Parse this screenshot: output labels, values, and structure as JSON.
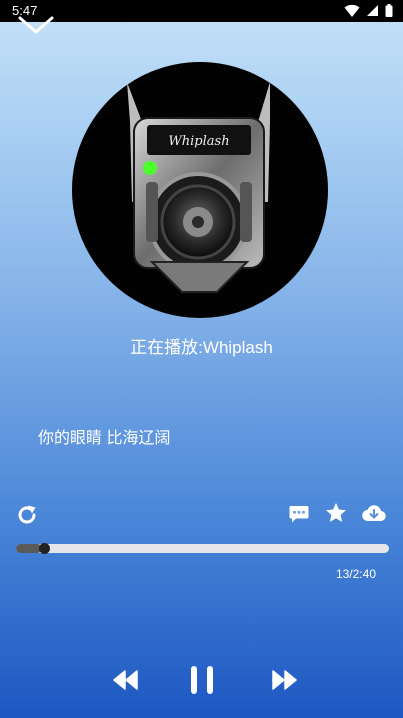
{
  "status_bar": {
    "time": "5:47"
  },
  "player": {
    "now_playing": "正在播放:Whiplash",
    "album_art_text": "Whiplash",
    "lyric_line": "你的眼睛 比海辽阔",
    "progress": {
      "fraction": 0.045,
      "time_display": "13/2:40"
    }
  },
  "icons": {
    "collapse": "chevron-down-icon",
    "repeat": "repeat-icon",
    "comment": "comment-icon",
    "favorite": "star-icon",
    "download": "download-icon",
    "previous": "rewind-icon",
    "play_pause": "pause-icon",
    "next": "fast-forward-icon"
  },
  "colors": {
    "accent_green": "#4bff2a",
    "track": "#e6e6ea"
  }
}
